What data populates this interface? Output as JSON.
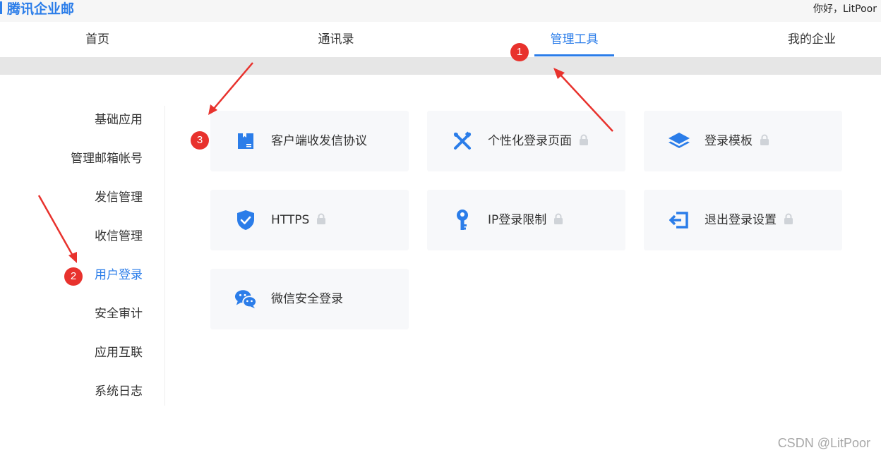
{
  "header": {
    "brand": "腾讯企业邮",
    "greeting": "你好，LitPoor"
  },
  "nav": {
    "items": [
      "首页",
      "通讯录",
      "管理工具",
      "我的企业"
    ],
    "active": "管理工具"
  },
  "sidebar": {
    "items": [
      "基础应用",
      "管理邮箱帐号",
      "发信管理",
      "收信管理",
      "用户登录",
      "安全审计",
      "应用互联",
      "系统日志"
    ],
    "active": "用户登录"
  },
  "cards": [
    {
      "label": "客户端收发信协议",
      "icon": "client-protocol-icon",
      "locked": false
    },
    {
      "label": "个性化登录页面",
      "icon": "tools-icon",
      "locked": true
    },
    {
      "label": "登录模板",
      "icon": "layers-icon",
      "locked": true
    },
    {
      "label": "HTTPS",
      "icon": "shield-check-icon",
      "locked": true
    },
    {
      "label": "IP登录限制",
      "icon": "key-icon",
      "locked": true
    },
    {
      "label": "退出登录设置",
      "icon": "logout-icon",
      "locked": true
    },
    {
      "label": "微信安全登录",
      "icon": "wechat-icon",
      "locked": false
    }
  ],
  "annotations": {
    "badges": [
      "1",
      "2",
      "3"
    ]
  },
  "watermark": "CSDN @LitPoor",
  "colors": {
    "accent": "#2b7de9",
    "badge": "#e8322d",
    "card_bg": "#f7f8fa"
  }
}
